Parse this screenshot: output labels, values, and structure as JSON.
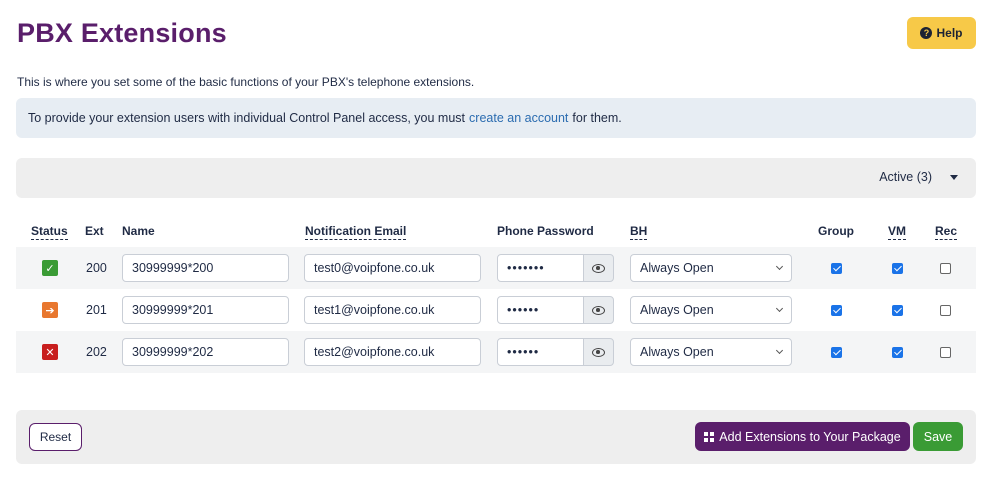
{
  "header": {
    "title": "PBX Extensions",
    "help_label": "Help",
    "help_icon": "question-circle-icon"
  },
  "intro_text": "This is where you set some of the basic functions of your PBX's telephone extensions.",
  "info": {
    "text_before": "To provide your extension users with individual Control Panel access, you must",
    "link_text": "create an account",
    "text_after": "for them."
  },
  "filter": {
    "selected": "Active (3)"
  },
  "table": {
    "headers": {
      "status": "Status",
      "ext": "Ext",
      "name": "Name",
      "email": "Notification Email",
      "password": "Phone Password",
      "bh": "BH",
      "group": "Group",
      "vm": "VM",
      "rec": "Rec"
    },
    "rows": [
      {
        "status": "active",
        "status_icon": "check-icon",
        "status_glyph": "✓",
        "status_color": "#3a9b35",
        "ext": "200",
        "name": "30999999*200",
        "email": "test0@voipfone.co.uk",
        "password_mask": "•••••••",
        "bh": "Always Open",
        "group": true,
        "vm": true,
        "rec": false
      },
      {
        "status": "forwarding",
        "status_icon": "arrow-right-icon",
        "status_glyph": "➔",
        "status_color": "#e8772e",
        "ext": "201",
        "name": "30999999*201",
        "email": "test1@voipfone.co.uk",
        "password_mask": "••••••",
        "bh": "Always Open",
        "group": true,
        "vm": true,
        "rec": false
      },
      {
        "status": "disabled",
        "status_icon": "close-icon",
        "status_glyph": "✕",
        "status_color": "#c81e1e",
        "ext": "202",
        "name": "30999999*202",
        "email": "test2@voipfone.co.uk",
        "password_mask": "••••••",
        "bh": "Always Open",
        "group": true,
        "vm": true,
        "rec": false
      }
    ]
  },
  "footer": {
    "reset_label": "Reset",
    "add_label": "Add Extensions to Your Package",
    "save_label": "Save"
  },
  "colors": {
    "brand_purple": "#5a1e6b",
    "help_yellow": "#f7c948",
    "save_green": "#3a9b35",
    "link_blue": "#2b6cb0",
    "checkbox_blue": "#1a73e8"
  }
}
